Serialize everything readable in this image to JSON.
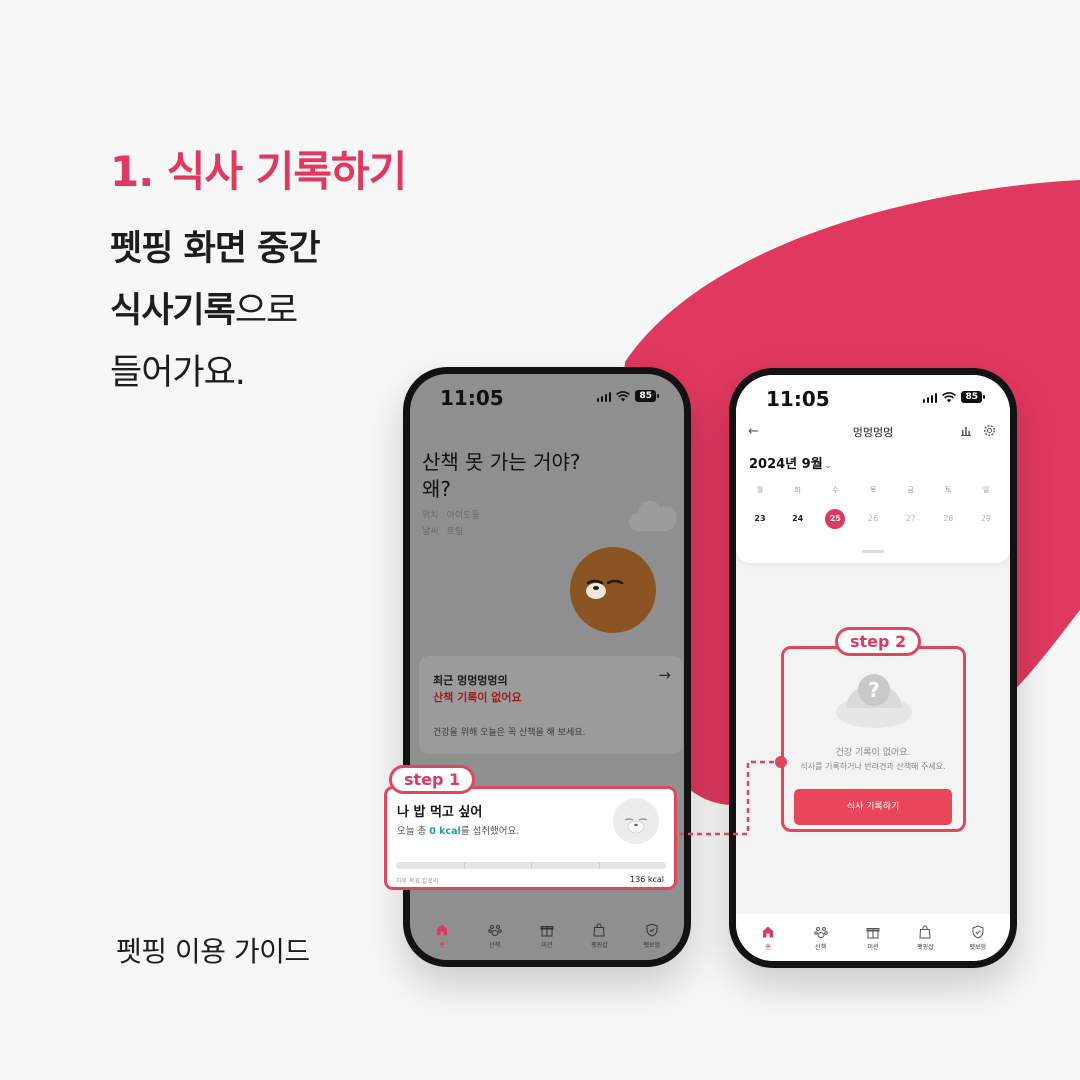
{
  "colors": {
    "accent": "#e0385f",
    "teal": "#13a89e",
    "button": "#e8475b"
  },
  "guide": {
    "title": "1. 식사 기록하기",
    "desc_line1": "펫핑 화면 중간",
    "desc_line2_bold": "식사기록",
    "desc_line2_rest": "으로",
    "desc_line3": "들어가요.",
    "footer": "펫핑 이용 가이드"
  },
  "phone1": {
    "status": {
      "time": "11:05",
      "battery": "85"
    },
    "headline": "산책 못 가는 거야?\n왜?",
    "meta": {
      "location_label": "위치",
      "location_value": "아이도동",
      "weather_label": "날씨",
      "weather_value": "흐림"
    },
    "recent_card": {
      "line1": "최근 멍멍멍멍의",
      "line2": "산책 기록이 없어요",
      "subtitle": "건강을 위해 오늘은 꼭 산책을 해 보세요.",
      "arrow_icon": "arrow-right-icon"
    },
    "meal_card": {
      "title": "나 밥 먹고 싶어",
      "subtitle_prefix": "오늘 총 ",
      "subtitle_kcal": "0 kcal",
      "subtitle_suffix": "를 섭취했어요.",
      "progress_fraction": 0,
      "goal_label": "하루 목표 칼로리",
      "goal_value": "136 kcal"
    }
  },
  "phone2": {
    "status": {
      "time": "11:05",
      "battery": "85"
    },
    "nav_title": "멍멍멍멍",
    "month": "2024년 9월",
    "weekdays": [
      "월",
      "화",
      "수",
      "목",
      "금",
      "토",
      "일"
    ],
    "dates": [
      "23",
      "24",
      "25",
      "26",
      "27",
      "28",
      "29"
    ],
    "today_index": 2,
    "empty_title": "건강 기록이 없어요.",
    "empty_desc": "식사를 기록하거나 반려견과 산책해 주세요.",
    "button_label": "식사 기록하기"
  },
  "tabs": [
    {
      "label": "홈",
      "icon": "home-icon"
    },
    {
      "label": "산책",
      "icon": "paw-icon"
    },
    {
      "label": "미션",
      "icon": "gift-icon"
    },
    {
      "label": "펫핑샵",
      "icon": "shopping-bag-icon"
    },
    {
      "label": "펫보험",
      "icon": "shield-icon"
    }
  ],
  "steps": {
    "step1": "step 1",
    "step2": "step 2"
  }
}
